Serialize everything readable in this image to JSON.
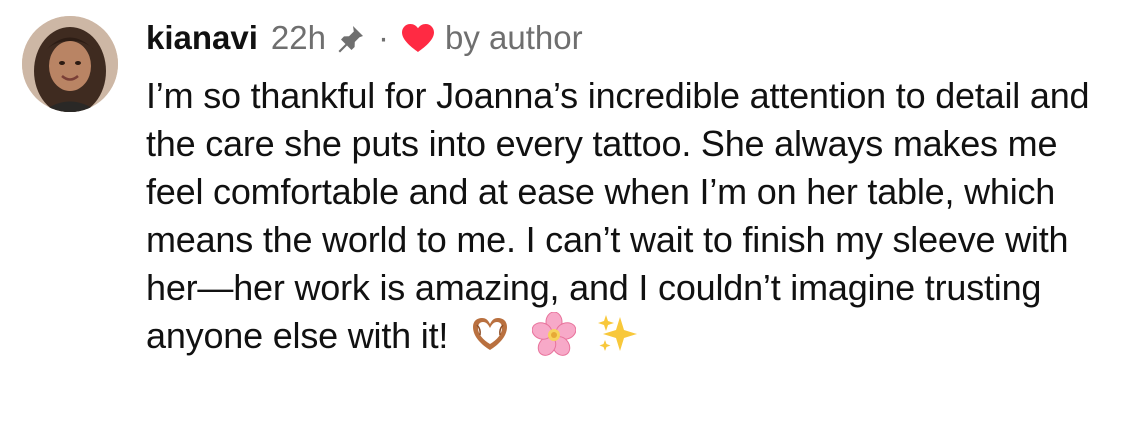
{
  "comment": {
    "username": "kianavi",
    "time": "22h",
    "separator": "·",
    "author_badge": "by author",
    "text": "I’m so thankful for Joanna’s incredible attention to detail and the care she puts into every tattoo. She always makes me feel comfortable and at ease when I’m on her table, which means the world to me. I can’t wait to finish my sleeve with her—her work is amazing, and I couldn’t imagine trusting anyone else with it!",
    "emojis": [
      "🫶",
      "🌸",
      "✨"
    ]
  },
  "icons": {
    "pin": "pin-icon",
    "heart": "heart-icon",
    "heart_color": "#ff2a43"
  }
}
